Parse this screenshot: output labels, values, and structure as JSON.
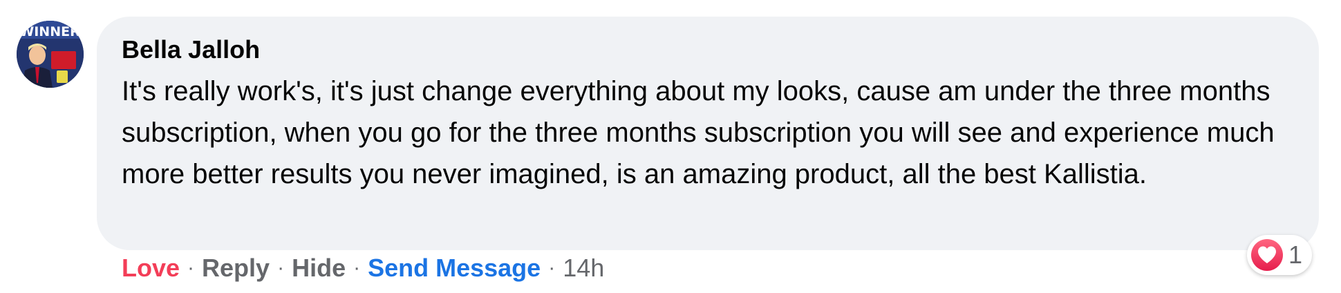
{
  "comment": {
    "avatar": {
      "banner_text": "WINNER",
      "alt": "Bella Jalloh profile picture"
    },
    "author": "Bella Jalloh",
    "text": "It's really work's, it's just change everything about my looks, cause am under the three months subscription, when you go for the three months subscription you will see and experience much more better results you never imagined, is an amazing product, all the best Kallistia.",
    "reactions": {
      "icon": "heart-icon",
      "count": "1"
    },
    "actions": {
      "love_label": "Love",
      "reply_label": "Reply",
      "hide_label": "Hide",
      "send_message_label": "Send Message",
      "separator": "·",
      "timestamp": "14h"
    }
  },
  "colors": {
    "bubble": "#f0f2f5",
    "love": "#f33e58",
    "link_blue": "#1b74e4",
    "secondary_text": "#65676b",
    "primary_text": "#050505"
  }
}
